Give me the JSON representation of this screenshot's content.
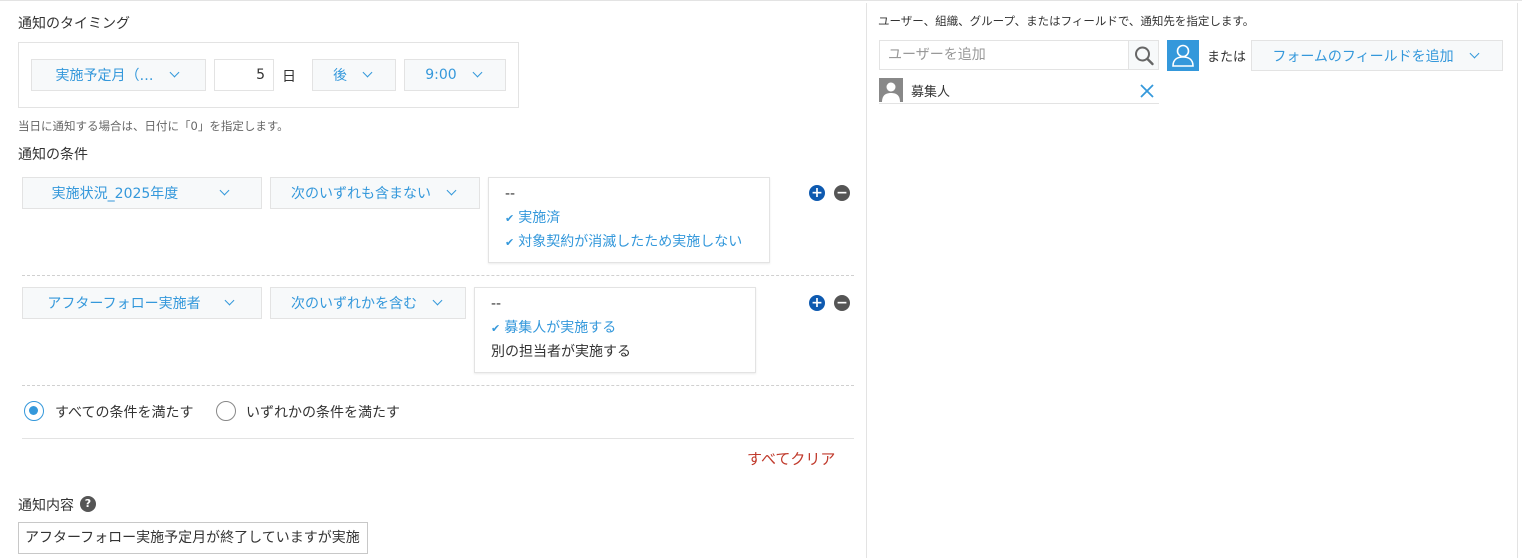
{
  "timing": {
    "title": "通知のタイミング",
    "field": "実施予定月（…",
    "days": "5",
    "days_unit": "日",
    "direction": "後",
    "time": "9:00",
    "hint": "当日に通知する場合は、日付に「0」を指定します。"
  },
  "conditions": {
    "title": "通知の条件",
    "rows": [
      {
        "field": "実施状況_2025年度",
        "operator": "次のいずれも含まない",
        "options": [
          {
            "label": "--",
            "selected": false
          },
          {
            "label": "実施済",
            "selected": true
          },
          {
            "label": "対象契約が消滅したため実施しない",
            "selected": true
          }
        ]
      },
      {
        "field": "アフターフォロー実施者",
        "operator": "次のいずれかを含む",
        "options": [
          {
            "label": "--",
            "selected": false
          },
          {
            "label": "募集人が実施する",
            "selected": true
          },
          {
            "label": "別の担当者が実施する",
            "selected": false
          }
        ]
      }
    ],
    "add_symbol": "+",
    "remove_symbol": "−",
    "match_all_label": "すべての条件を満たす",
    "match_any_label": "いずれかの条件を満たす",
    "match_selected": "all",
    "clear_all": "すべてクリア"
  },
  "content": {
    "title": "通知内容",
    "help_symbol": "?",
    "value": "アフターフォロー実施予定月が終了していますが実施"
  },
  "recipients": {
    "hint": "ユーザー、組織、グループ、またはフィールドで、通知先を指定します。",
    "user_placeholder": "ユーザーを追加",
    "or_label": "または",
    "field_dropdown": "フォームのフィールドを追加",
    "entries": [
      {
        "name": "募集人"
      }
    ]
  },
  "colors": {
    "accent": "#3498db",
    "danger": "#c0392b",
    "border": "#e3e3e3"
  },
  "icons": {
    "search": "search-icon",
    "user_add": "user-icon",
    "remove": "close-icon",
    "chevron": "chevron-down-icon"
  }
}
